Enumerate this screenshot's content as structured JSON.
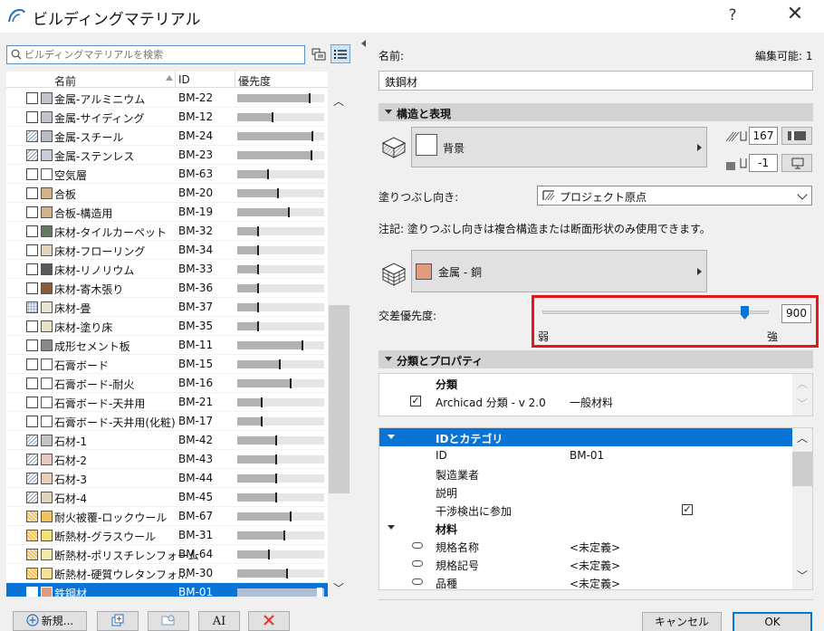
{
  "window": {
    "title": "ビルディングマテリアル",
    "help": "?",
    "close": "✕"
  },
  "search": {
    "placeholder": "ビルディングマテリアルを検索"
  },
  "list": {
    "headers": {
      "name": "名前",
      "id": "ID",
      "priority": "優先度"
    },
    "items": [
      {
        "name": "金属-アルミニウム",
        "id": "BM-22",
        "color": "#c0c4cc",
        "pattern": "",
        "priority": 0.84
      },
      {
        "name": "金属-サイディング",
        "id": "BM-12",
        "color": "#c0c4cc",
        "pattern": "",
        "priority": 0.42
      },
      {
        "name": "金属-スチール",
        "id": "BM-24",
        "color": "#b8bcc4",
        "pattern": "hatch",
        "priority": 0.88
      },
      {
        "name": "金属-ステンレス",
        "id": "BM-23",
        "color": "#c8cbd8",
        "pattern": "hatch",
        "priority": 0.86
      },
      {
        "name": "空気層",
        "id": "BM-63",
        "color": "#ffffff",
        "pattern": "",
        "priority": 0.36
      },
      {
        "name": "合板",
        "id": "BM-20",
        "color": "#d2b48c",
        "pattern": "",
        "priority": 0.48
      },
      {
        "name": "合板-構造用",
        "id": "BM-19",
        "color": "#d2b48c",
        "pattern": "",
        "priority": 0.6
      },
      {
        "name": "床材-タイルカーペット",
        "id": "BM-32",
        "color": "#5f7d5a",
        "pattern": "",
        "priority": 0.25
      },
      {
        "name": "床材-フローリング",
        "id": "BM-34",
        "color": "#e8d3c0",
        "pattern": "",
        "priority": 0.25
      },
      {
        "name": "床材-リノリウム",
        "id": "BM-33",
        "color": "#5a5a5a",
        "pattern": "",
        "priority": 0.25
      },
      {
        "name": "床材-寄木張り",
        "id": "BM-36",
        "color": "#8b5a3c",
        "pattern": "",
        "priority": 0.25
      },
      {
        "name": "床材-畳",
        "id": "BM-37",
        "color": "#e9e6d0",
        "pattern": "dots",
        "priority": 0.25
      },
      {
        "name": "床材-塗り床",
        "id": "BM-35",
        "color": "#e8e2c8",
        "pattern": "",
        "priority": 0.25
      },
      {
        "name": "成形セメント板",
        "id": "BM-11",
        "color": "#8a8a8a",
        "pattern": "",
        "priority": 0.76
      },
      {
        "name": "石膏ボード",
        "id": "BM-15",
        "color": "#ffffff",
        "pattern": "",
        "priority": 0.5
      },
      {
        "name": "石膏ボード-耐火",
        "id": "BM-16",
        "color": "#ffffff",
        "pattern": "",
        "priority": 0.63
      },
      {
        "name": "石膏ボード-天井用",
        "id": "BM-21",
        "color": "#ffffff",
        "pattern": "",
        "priority": 0.29
      },
      {
        "name": "石膏ボード-天井用(化粧)",
        "id": "BM-17",
        "color": "#ffffff",
        "pattern": "",
        "priority": 0.29
      },
      {
        "name": "石材-1",
        "id": "BM-42",
        "color": "#c4c4c4",
        "pattern": "hatch",
        "priority": 0.46
      },
      {
        "name": "石材-2",
        "id": "BM-43",
        "color": "#e6c9c0",
        "pattern": "hatch",
        "priority": 0.46
      },
      {
        "name": "石材-3",
        "id": "BM-44",
        "color": "#e8cdb8",
        "pattern": "hatch",
        "priority": 0.46
      },
      {
        "name": "石材-4",
        "id": "BM-45",
        "color": "#e0d4c0",
        "pattern": "hatch",
        "priority": 0.46
      },
      {
        "name": "耐火被覆-ロックウール",
        "id": "BM-67",
        "color": "#f3c25a",
        "pattern": "brick",
        "priority": 0.62
      },
      {
        "name": "断熱材-グラスウール",
        "id": "BM-31",
        "color": "#f7e07c",
        "pattern": "brick",
        "priority": 0.55
      },
      {
        "name": "断熱材-ポリスチレンフォーム",
        "id": "BM-64",
        "color": "#f3e9a8",
        "pattern": "brick",
        "priority": 0.38
      },
      {
        "name": "断熱材-硬質ウレタンフォ...",
        "id": "BM-30",
        "color": "#f3e09a",
        "pattern": "brick",
        "priority": 0.58
      },
      {
        "name": "鉄鋼材",
        "id": "BM-01",
        "color": "#e29a82",
        "pattern": "",
        "priority": 0.94,
        "selected": true
      }
    ]
  },
  "footer_left": {
    "new": "新規...",
    "ax": "AI"
  },
  "editor": {
    "name_label": "名前:",
    "editable_label": "編集可能: 1",
    "name_value": "鉄鋼材",
    "structure_section": "構造と表現",
    "background_label": "背景",
    "pen_top": "167",
    "pen_bottom": "-1",
    "fill_orientation_label": "塗りつぶし向き:",
    "fill_orientation_value": "プロジェクト原点",
    "note": "注記: 塗りつぶし向きは複合構造または断面形状のみ使用できます。",
    "surface_label": "金属 - 銅",
    "intersection_label": "交差優先度:",
    "intersection_value": "900",
    "weak": "弱",
    "strong": "強",
    "class_section": "分類とプロパティ",
    "class_header": "分類",
    "class_row_name": "Archicad 分類 - v 2.0",
    "class_row_value": "一般材料",
    "id_category": "IDとカテゴリ",
    "rows": [
      {
        "label": "ID",
        "value": "BM-01"
      },
      {
        "label": "製造業者",
        "value": ""
      },
      {
        "label": "説明",
        "value": ""
      },
      {
        "label": "干渉検出に参加",
        "value": ""
      }
    ],
    "materials_group": "材料",
    "material_rows": [
      {
        "label": "規格名称",
        "value": "<未定義>"
      },
      {
        "label": "規格記号",
        "value": "<未定義>"
      },
      {
        "label": "品種",
        "value": "<未定義>"
      }
    ]
  },
  "dialog": {
    "cancel": "キャンセル",
    "ok": "OK"
  }
}
